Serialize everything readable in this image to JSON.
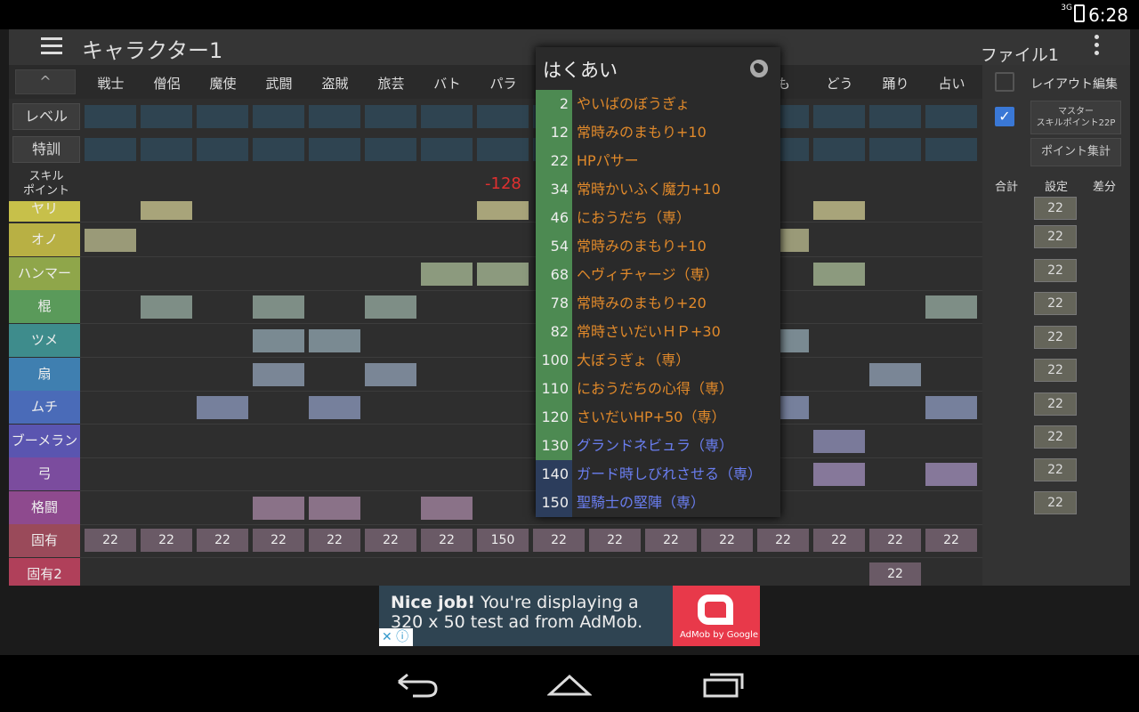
{
  "status": {
    "network": "3G",
    "time": "6:28"
  },
  "appbar": {
    "title": "キャラクター1",
    "file": "ファイル1"
  },
  "header": {
    "caret": "^",
    "columns": [
      "戦士",
      "僧侶",
      "魔使",
      "武闘",
      "盗賊",
      "旅芸",
      "バト",
      "パラ",
      "",
      "",
      "",
      "",
      "も",
      "どう",
      "踊り",
      "占い"
    ]
  },
  "rows_top": {
    "level": "レベル",
    "training": "特訓",
    "skill_points": "スキル\nポイント",
    "negative": "-128"
  },
  "categories": [
    "ヤリ",
    "オノ",
    "ハンマー",
    "棍",
    "ツメ",
    "扇",
    "ムチ",
    "ブーメラン",
    "弓",
    "格闘",
    "固有",
    "固有2"
  ],
  "category_colors": [
    "#c7c04a",
    "#b8b044",
    "#8fa64a",
    "#5a9a5a",
    "#3e8c8c",
    "#3f7fb0",
    "#4a6bb8",
    "#5a55b0",
    "#7b4c9e",
    "#8e4a8e",
    "#9a4a5a",
    "#b0405a"
  ],
  "unique_row": [
    "22",
    "22",
    "22",
    "22",
    "22",
    "22",
    "22",
    "150",
    "22",
    "22",
    "22",
    "22",
    "22",
    "22",
    "22",
    "22"
  ],
  "unique2_row": {
    "value": "22"
  },
  "side": {
    "layout_edit": "レイアウト編集",
    "master_line1": "マスター",
    "master_line2": "スキルポイント22P",
    "points_total": "ポイント集計",
    "col_total": "合計",
    "col_setting": "設定",
    "col_diff": "差分",
    "setting_values": [
      "22",
      "22",
      "22",
      "22",
      "22",
      "22",
      "22",
      "22",
      "22",
      "22"
    ]
  },
  "popup": {
    "title": "はくあい",
    "items": [
      {
        "num": "2",
        "name": "やいばのぼうぎょ",
        "color": "#e0892a"
      },
      {
        "num": "12",
        "name": "常時みのまもり+10",
        "color": "#e0892a"
      },
      {
        "num": "22",
        "name": "HPパサー",
        "color": "#e0892a"
      },
      {
        "num": "34",
        "name": "常時かいふく魔力+10",
        "color": "#e0892a"
      },
      {
        "num": "46",
        "name": "におうだち（専）",
        "color": "#e0892a"
      },
      {
        "num": "54",
        "name": "常時みのまもり+10",
        "color": "#e0892a"
      },
      {
        "num": "68",
        "name": "ヘヴィチャージ（専）",
        "color": "#e0892a"
      },
      {
        "num": "78",
        "name": "常時みのまもり+20",
        "color": "#e0892a"
      },
      {
        "num": "82",
        "name": "常時さいだいＨＰ+30",
        "color": "#e0892a"
      },
      {
        "num": "100",
        "name": "大ぼうぎょ（専）",
        "color": "#e0892a"
      },
      {
        "num": "110",
        "name": "におうだちの心得（専）",
        "color": "#e0892a"
      },
      {
        "num": "120",
        "name": "さいだいHP+50（専）",
        "color": "#e0892a"
      },
      {
        "num": "130",
        "name": "グランドネビュラ（専）",
        "color": "#6a7ef0"
      },
      {
        "num": "140",
        "name": "ガード時しびれさせる（専）",
        "color": "#6a7ef0"
      },
      {
        "num": "150",
        "name": "聖騎士の堅陣（専）",
        "color": "#6a7ef0"
      }
    ]
  },
  "ad": {
    "bold": "Nice job!",
    "text": " You're displaying a 320 x 50 test ad from AdMob.",
    "brand": "AdMob by Google"
  }
}
